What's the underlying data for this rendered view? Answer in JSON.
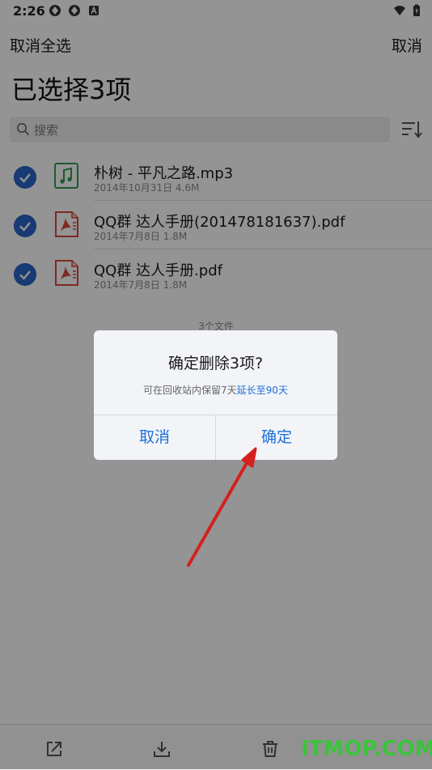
{
  "status_bar": {
    "time": "2:26"
  },
  "header": {
    "deselect_all": "取消全选",
    "cancel": "取消",
    "title": "已选择3项"
  },
  "search": {
    "placeholder": "搜索"
  },
  "files": [
    {
      "name": "朴树 - 平凡之路.mp3",
      "meta": "2014年10月31日  4.6M",
      "type": "music"
    },
    {
      "name": "QQ群 达人手册(201478181637).pdf",
      "meta": "2014年7月8日  1.8M",
      "type": "pdf"
    },
    {
      "name": "QQ群 达人手册.pdf",
      "meta": "2014年7月8日  1.8M",
      "type": "pdf"
    }
  ],
  "file_count": "3个文件",
  "dialog": {
    "title": "确定删除3项?",
    "subtitle_prefix": "可在回收站内保留7天",
    "subtitle_link": "延长至90天",
    "cancel": "取消",
    "confirm": "确定"
  },
  "watermark": "ITMOP.COM",
  "colors": {
    "accent": "#1e6fd9",
    "check": "#2a66c9",
    "arrow": "#d42020",
    "watermark": "#3cc33c"
  }
}
